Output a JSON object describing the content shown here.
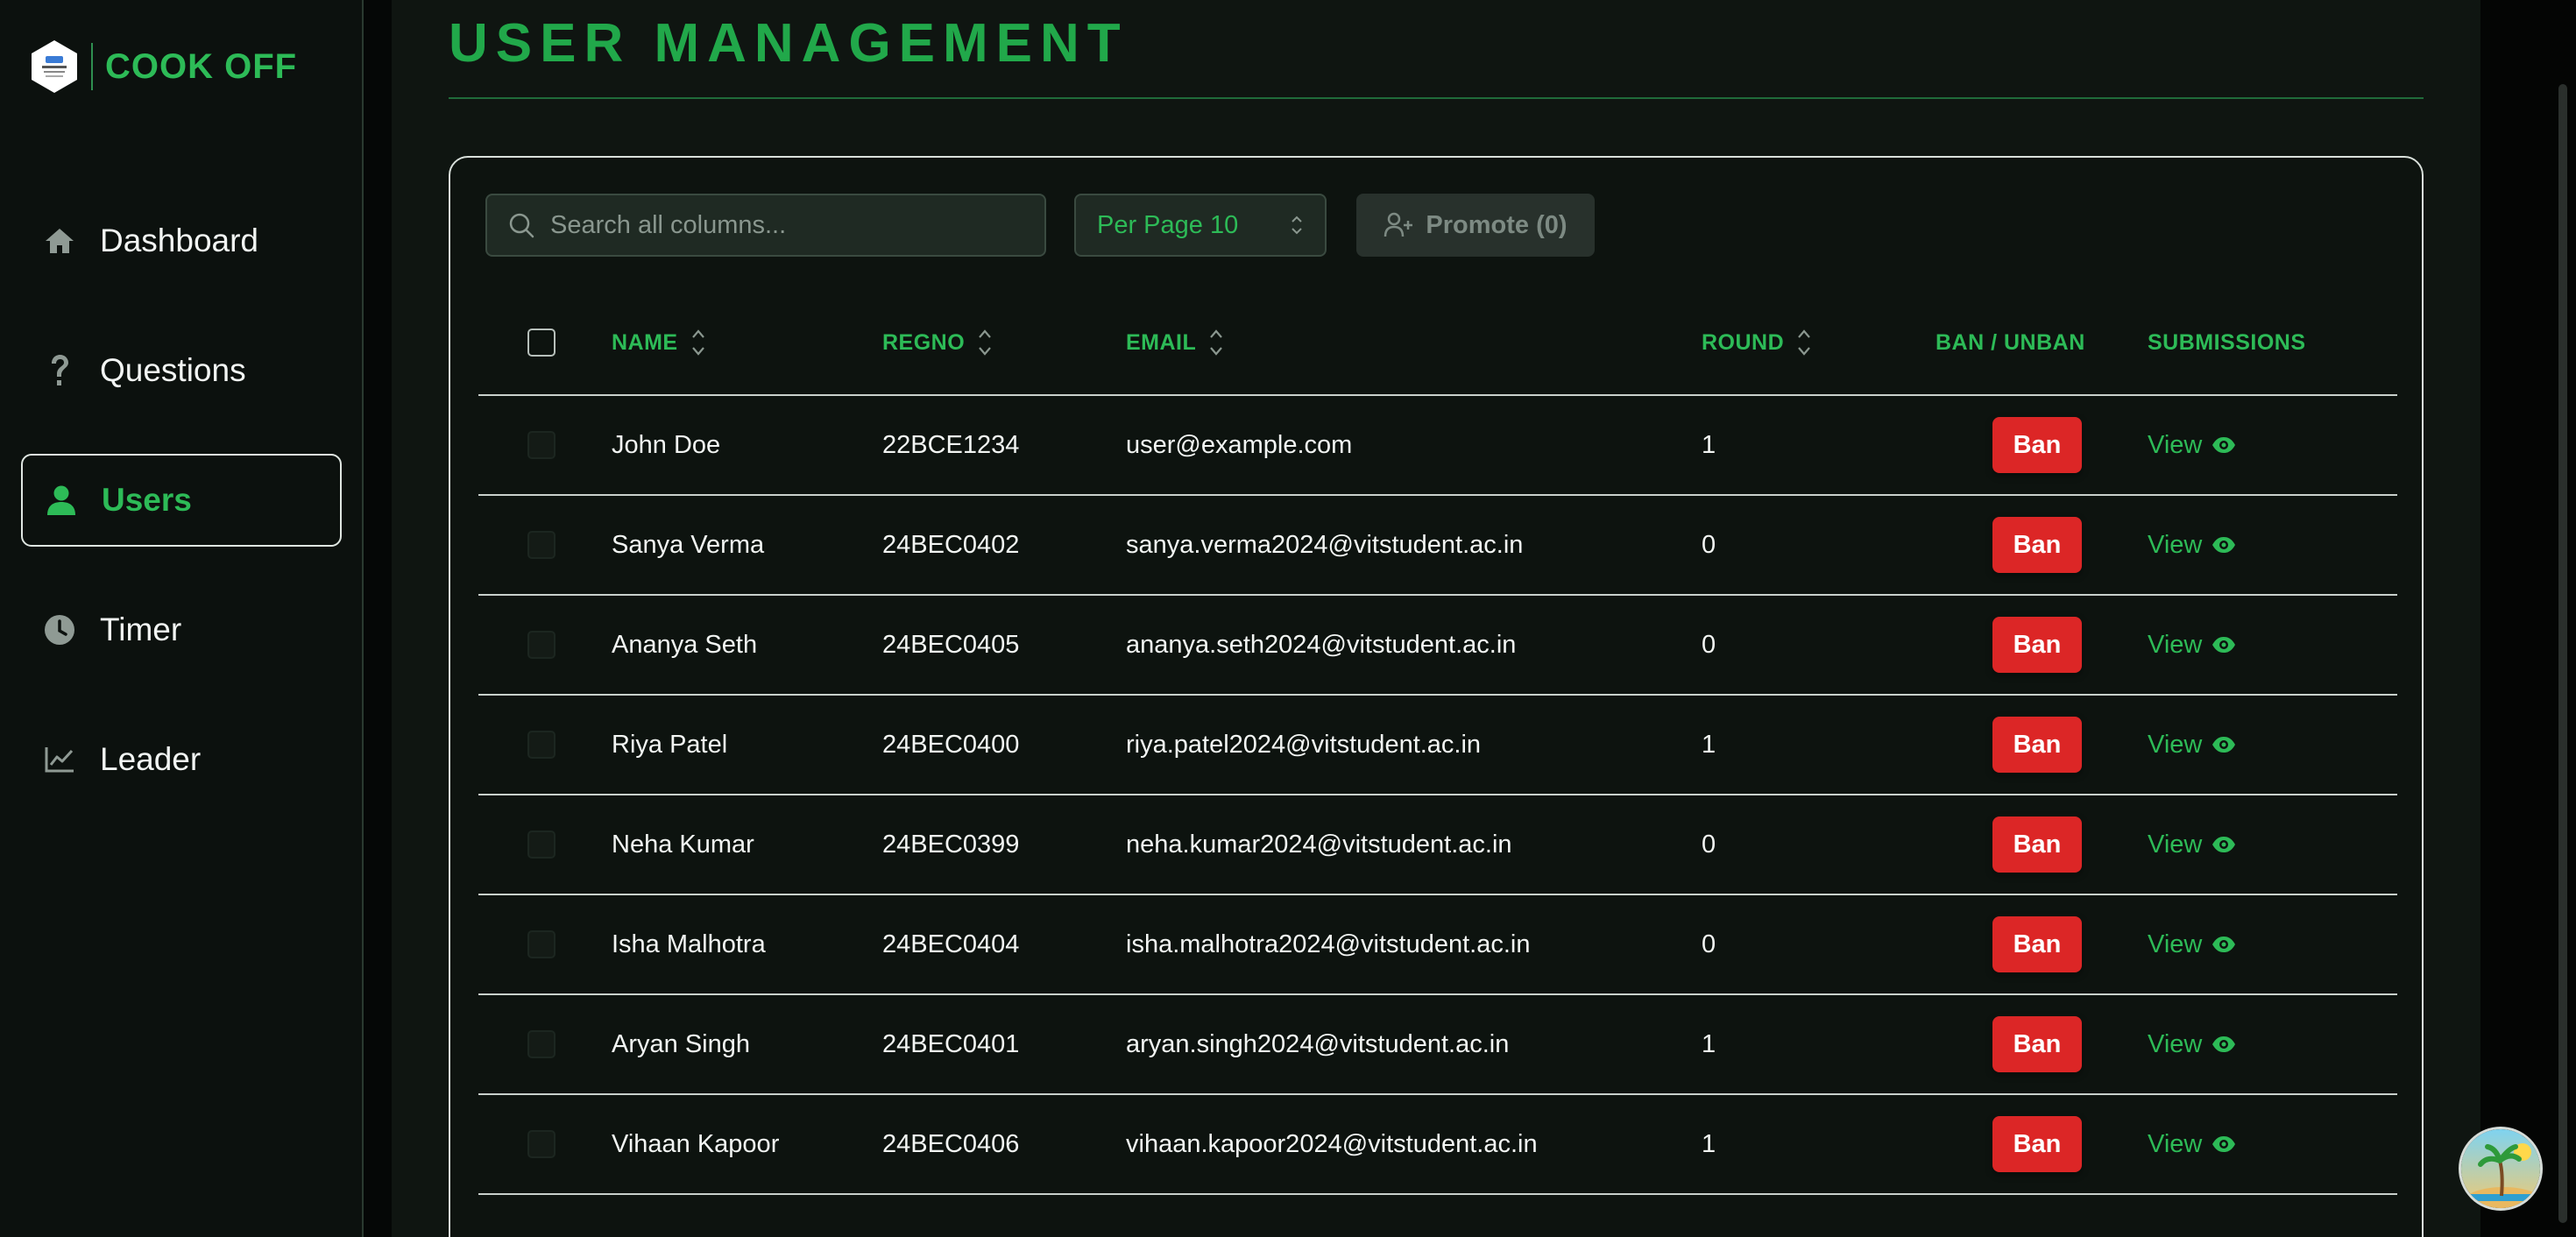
{
  "brand": {
    "name": "COOK OFF"
  },
  "sidebar": {
    "items": [
      {
        "label": "Dashboard",
        "icon": "home-icon",
        "active": false
      },
      {
        "label": "Questions",
        "icon": "question-icon",
        "active": false
      },
      {
        "label": "Users",
        "icon": "user-icon",
        "active": true
      },
      {
        "label": "Timer",
        "icon": "clock-icon",
        "active": false
      },
      {
        "label": "Leader",
        "icon": "chart-line-icon",
        "active": false
      }
    ]
  },
  "main": {
    "title": "USER MANAGEMENT",
    "search": {
      "placeholder": "Search all columns...",
      "value": ""
    },
    "per_page": {
      "label": "Per Page 10"
    },
    "promote": {
      "label": "Promote (0)"
    }
  },
  "table": {
    "columns": {
      "name": "NAME",
      "regno": "REGNO",
      "email": "EMAIL",
      "round": "ROUND",
      "ban": "BAN / UNBAN",
      "submissions": "SUBMISSIONS"
    },
    "ban_label": "Ban",
    "view_label": "View",
    "rows": [
      {
        "name": "John Doe",
        "regno": "22BCE1234",
        "email": "user@example.com",
        "round": "1"
      },
      {
        "name": "Sanya Verma",
        "regno": "24BEC0402",
        "email": "sanya.verma2024@vitstudent.ac.in",
        "round": "0"
      },
      {
        "name": "Ananya Seth",
        "regno": "24BEC0405",
        "email": "ananya.seth2024@vitstudent.ac.in",
        "round": "0"
      },
      {
        "name": "Riya Patel",
        "regno": "24BEC0400",
        "email": "riya.patel2024@vitstudent.ac.in",
        "round": "1"
      },
      {
        "name": "Neha Kumar",
        "regno": "24BEC0399",
        "email": "neha.kumar2024@vitstudent.ac.in",
        "round": "0"
      },
      {
        "name": "Isha Malhotra",
        "regno": "24BEC0404",
        "email": "isha.malhotra2024@vitstudent.ac.in",
        "round": "0"
      },
      {
        "name": "Aryan Singh",
        "regno": "24BEC0401",
        "email": "aryan.singh2024@vitstudent.ac.in",
        "round": "1"
      },
      {
        "name": "Vihaan Kapoor",
        "regno": "24BEC0406",
        "email": "vihaan.kapoor2024@vitstudent.ac.in",
        "round": "1"
      }
    ]
  },
  "colors": {
    "accent": "#2dbb57",
    "danger": "#dc2626",
    "background": "#0f1511"
  }
}
